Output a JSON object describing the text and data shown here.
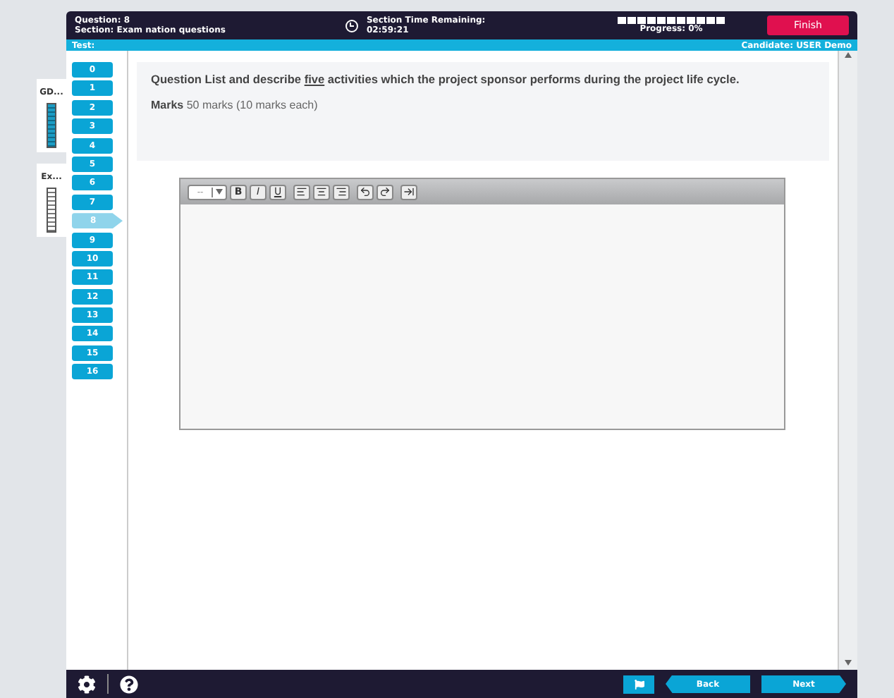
{
  "header": {
    "question": "Question: 8",
    "section": "Section: Exam nation questions",
    "timer_label": "Section Time Remaining:",
    "timer_value": "02:59:21",
    "progress": "Progress: 0%",
    "finish_button": "Finish"
  },
  "subheader": {
    "test": "Test:",
    "candidate": "Candidate: USER Demo"
  },
  "sections": [
    {
      "label": "GD...",
      "level": 1
    },
    {
      "label": "Ex...",
      "level": 0
    }
  ],
  "questions": [
    {
      "label": "0",
      "selected": false
    },
    {
      "label": "1",
      "selected": false
    },
    {
      "label": "2",
      "selected": false
    },
    {
      "label": "3",
      "selected": false
    },
    {
      "label": "4",
      "selected": false
    },
    {
      "label": "5",
      "selected": false
    },
    {
      "label": "6",
      "selected": false
    },
    {
      "label": "7",
      "selected": false
    },
    {
      "label": "8",
      "selected": true
    },
    {
      "label": "9",
      "selected": false
    },
    {
      "label": "10",
      "selected": false
    },
    {
      "label": "11",
      "selected": false
    },
    {
      "label": "12",
      "selected": false
    },
    {
      "label": "13",
      "selected": false
    },
    {
      "label": "14",
      "selected": false
    },
    {
      "label": "15",
      "selected": false
    },
    {
      "label": "16",
      "selected": false
    }
  ],
  "question": {
    "label": "Question",
    "text_before": "List and describe ",
    "underlined": "five",
    "text_after": " activities which the project sponsor performs during the project life cycle.",
    "marks_label": "Marks",
    "marks": "50 marks (10 marks each)"
  },
  "editor": {
    "format_value": "--",
    "tools": [
      {
        "kind": "bold",
        "label": "B"
      },
      {
        "kind": "italic",
        "label": "I"
      },
      {
        "kind": "underline",
        "label": "U"
      }
    ]
  },
  "footer": {
    "back": "Back",
    "next": "Next"
  }
}
